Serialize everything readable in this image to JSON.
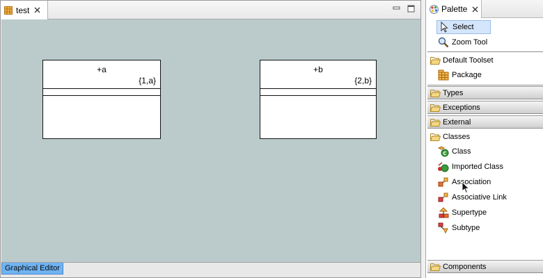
{
  "editor": {
    "tab": {
      "label": "test",
      "icon": "grid-diagram-icon"
    },
    "bottom_tab": "Graphical Editor",
    "canvas_color": "#bbcbcb",
    "classes": [
      {
        "name": "+a",
        "tag": "{1,a}"
      },
      {
        "name": "+b",
        "tag": "{2,b}"
      }
    ]
  },
  "palette": {
    "tab": {
      "label": "Palette",
      "icon": "palette-icon"
    },
    "tools": [
      {
        "label": "Select",
        "icon": "arrow-cursor-icon",
        "selected": true
      },
      {
        "label": "Zoom Tool",
        "icon": "zoom-icon"
      }
    ],
    "default_toolset": {
      "label": "Default Toolset",
      "items": [
        {
          "label": "Package",
          "icon": "package-icon"
        }
      ]
    },
    "collapsed_drawers": [
      "Types",
      "Exceptions",
      "External"
    ],
    "classes_drawer": {
      "label": "Classes",
      "items": [
        {
          "label": "Class",
          "icon": "class-icon"
        },
        {
          "label": "Imported Class",
          "icon": "imported-class-icon"
        },
        {
          "label": "Association",
          "icon": "association-icon"
        },
        {
          "label": "Associative Link",
          "icon": "associative-link-icon"
        },
        {
          "label": "Supertype",
          "icon": "supertype-icon"
        },
        {
          "label": "Subtype",
          "icon": "subtype-icon"
        }
      ]
    },
    "components_drawer": "Components"
  }
}
